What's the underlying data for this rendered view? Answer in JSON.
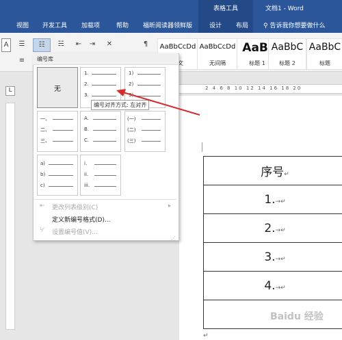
{
  "titlebar": {
    "context_title": "表格工具",
    "document_title": "文档1 - Word"
  },
  "tabs": [
    {
      "label": "视图"
    },
    {
      "label": "开发工具"
    },
    {
      "label": "加载项"
    },
    {
      "label": "帮助"
    },
    {
      "label": "福昕阅读器领鲜版"
    },
    {
      "label": "设计"
    },
    {
      "label": "布局"
    }
  ],
  "search": {
    "icon": "search-icon",
    "label": "告诉我你想要做什么"
  },
  "styles": [
    {
      "sample": "AaBbCcDd",
      "name": "正文"
    },
    {
      "sample": "AaBbCcDd",
      "name": "无间隔"
    },
    {
      "sample": "AaBl",
      "name": "标题 1"
    },
    {
      "sample": "AaBbC",
      "name": "标题 2"
    },
    {
      "sample": "AaBbC",
      "name": "标题"
    }
  ],
  "dropdown": {
    "header": "编号库",
    "none_label": "无",
    "tooltip": "编号对齐方式: 左对齐",
    "lists": [
      [
        "1.",
        "2.",
        "3."
      ],
      [
        "1)",
        "2)",
        "3)"
      ],
      [
        "一、",
        "二、",
        "三、"
      ],
      [
        "A.",
        "B.",
        "C."
      ],
      [
        "(一)",
        "(二)",
        "(三)"
      ],
      [
        "a)",
        "b)",
        "c)"
      ],
      [
        "i.",
        "ii.",
        "iii."
      ]
    ],
    "menu": [
      {
        "label": "更改列表级别(C)",
        "enabled": false
      },
      {
        "label": "定义新编号格式(D)...",
        "enabled": true
      },
      {
        "label": "设置编号值(V)...",
        "enabled": false
      }
    ]
  },
  "table": {
    "header": "序号",
    "rows": [
      "1.",
      "2.",
      "3.",
      "4.",
      ""
    ]
  },
  "ruler_numbers": "2 4 6 8 10 12 14 16 18 20",
  "colors": {
    "title_bar": "#2b579a",
    "accent_arrow": "#d92b2b"
  },
  "watermark": "Baidu 经验"
}
